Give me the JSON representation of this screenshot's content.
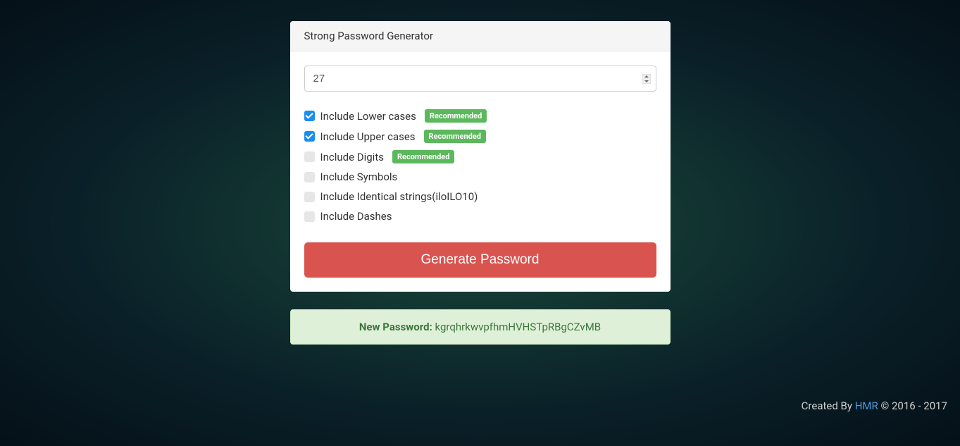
{
  "panel": {
    "title": "Strong Password Generator",
    "lengthValue": "27"
  },
  "options": [
    {
      "label": "Include Lower cases",
      "checked": true,
      "recommended": true
    },
    {
      "label": "Include Upper cases",
      "checked": true,
      "recommended": true
    },
    {
      "label": "Include Digits",
      "checked": false,
      "recommended": true
    },
    {
      "label": "Include Symbols",
      "checked": false,
      "recommended": false
    },
    {
      "label": "Include Identical strings(iloILO10)",
      "checked": false,
      "recommended": false
    },
    {
      "label": "Include Dashes",
      "checked": false,
      "recommended": false
    }
  ],
  "badge": {
    "recommended": "Recommended"
  },
  "buttons": {
    "generate": "Generate Password"
  },
  "result": {
    "label": "New Password: ",
    "value": "kgrqhrkwvpfhmHVHSTpRBgCZvMB"
  },
  "footer": {
    "prefix": "Created By ",
    "link": "HMR",
    "suffix": " © 2016 - 2017"
  }
}
